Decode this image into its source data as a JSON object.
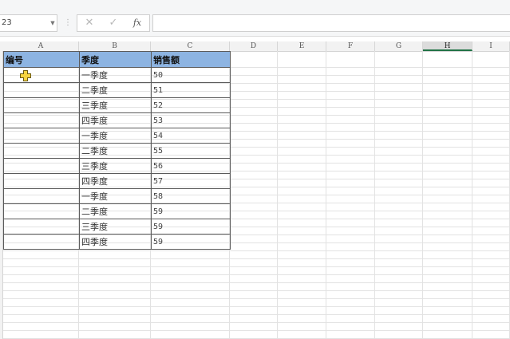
{
  "formula_bar": {
    "name_box": "23",
    "cancel_icon": "✕",
    "confirm_icon": "✓",
    "fx_label": "fx",
    "formula_value": ""
  },
  "columns": [
    "A",
    "B",
    "C",
    "D",
    "E",
    "F",
    "G",
    "H",
    "I"
  ],
  "selected_column": "H",
  "table": {
    "headers": [
      "编号",
      "季度",
      "销售额"
    ],
    "rows": [
      {
        "id": "",
        "quarter": "一季度",
        "sales": "50"
      },
      {
        "id": "",
        "quarter": "二季度",
        "sales": "51"
      },
      {
        "id": "",
        "quarter": "三季度",
        "sales": "52"
      },
      {
        "id": "",
        "quarter": "四季度",
        "sales": "53"
      },
      {
        "id": "",
        "quarter": "一季度",
        "sales": "54"
      },
      {
        "id": "",
        "quarter": "二季度",
        "sales": "55"
      },
      {
        "id": "",
        "quarter": "三季度",
        "sales": "56"
      },
      {
        "id": "",
        "quarter": "四季度",
        "sales": "57"
      },
      {
        "id": "",
        "quarter": "一季度",
        "sales": "58"
      },
      {
        "id": "",
        "quarter": "二季度",
        "sales": "59"
      },
      {
        "id": "",
        "quarter": "三季度",
        "sales": "59"
      },
      {
        "id": "",
        "quarter": "四季度",
        "sales": "59"
      }
    ]
  },
  "colors": {
    "header_fill": "#8db4e2",
    "cursor_fill": "#f5d341"
  }
}
